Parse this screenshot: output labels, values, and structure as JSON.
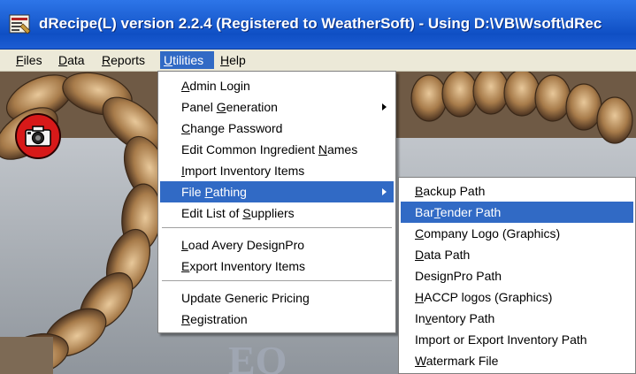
{
  "window": {
    "title": "dRecipe(L) version 2.2.4 (Registered to WeatherSoft) - Using D:\\VB\\Wsoft\\dRec"
  },
  "menubar": [
    {
      "pre": "",
      "u": "F",
      "post": "iles"
    },
    {
      "pre": "",
      "u": "D",
      "post": "ata"
    },
    {
      "pre": "",
      "u": "R",
      "post": "eports"
    },
    {
      "pre": "",
      "u": "U",
      "post": "tilities"
    },
    {
      "pre": "",
      "u": "H",
      "post": "elp"
    }
  ],
  "utilities_menu": {
    "items": [
      {
        "pre": "",
        "u": "A",
        "post": "dmin Login"
      },
      {
        "pre": "Panel ",
        "u": "G",
        "post": "eneration"
      },
      {
        "pre": "",
        "u": "C",
        "post": "hange Password"
      },
      {
        "pre": "Edit Common Ingredient ",
        "u": "N",
        "post": "ames"
      },
      {
        "pre": "",
        "u": "I",
        "post": "mport Inventory Items"
      },
      {
        "pre": "File ",
        "u": "P",
        "post": "athing"
      },
      {
        "pre": "Edit List of ",
        "u": "S",
        "post": "uppliers"
      },
      {
        "pre": "",
        "u": "L",
        "post": "oad Avery DesignPro"
      },
      {
        "pre": "",
        "u": "E",
        "post": "xport Inventory Items"
      },
      {
        "pre": "Update Generic Pricing",
        "u": "",
        "post": ""
      },
      {
        "pre": "",
        "u": "R",
        "post": "egistration"
      }
    ]
  },
  "file_pathing_menu": {
    "items": [
      {
        "pre": "",
        "u": "B",
        "post": "ackup Path"
      },
      {
        "pre": "Bar",
        "u": "T",
        "post": "ender Path"
      },
      {
        "pre": "",
        "u": "C",
        "post": "ompany Logo (Graphics)"
      },
      {
        "pre": "",
        "u": "D",
        "post": "ata Path"
      },
      {
        "pre": "Desi",
        "u": "g",
        "post": "nPro Path"
      },
      {
        "pre": "",
        "u": "H",
        "post": "ACCP logos (Graphics)"
      },
      {
        "pre": "In",
        "u": "v",
        "post": "entory Path"
      },
      {
        "pre": "Import or Export Inventory Path",
        "u": "",
        "post": ""
      },
      {
        "pre": "",
        "u": "W",
        "post": "atermark File"
      }
    ]
  },
  "background": {
    "partial_text": "EQ"
  },
  "colors": {
    "title_bar": "#1f63d6",
    "menu_bg": "#ece9d8",
    "highlight": "#316ac5",
    "camera_button": "#d71919"
  },
  "icons": {
    "app_icon": "drecipe-app-icon",
    "camera": "camera-icon",
    "submenu": "submenu-arrow-icon"
  }
}
